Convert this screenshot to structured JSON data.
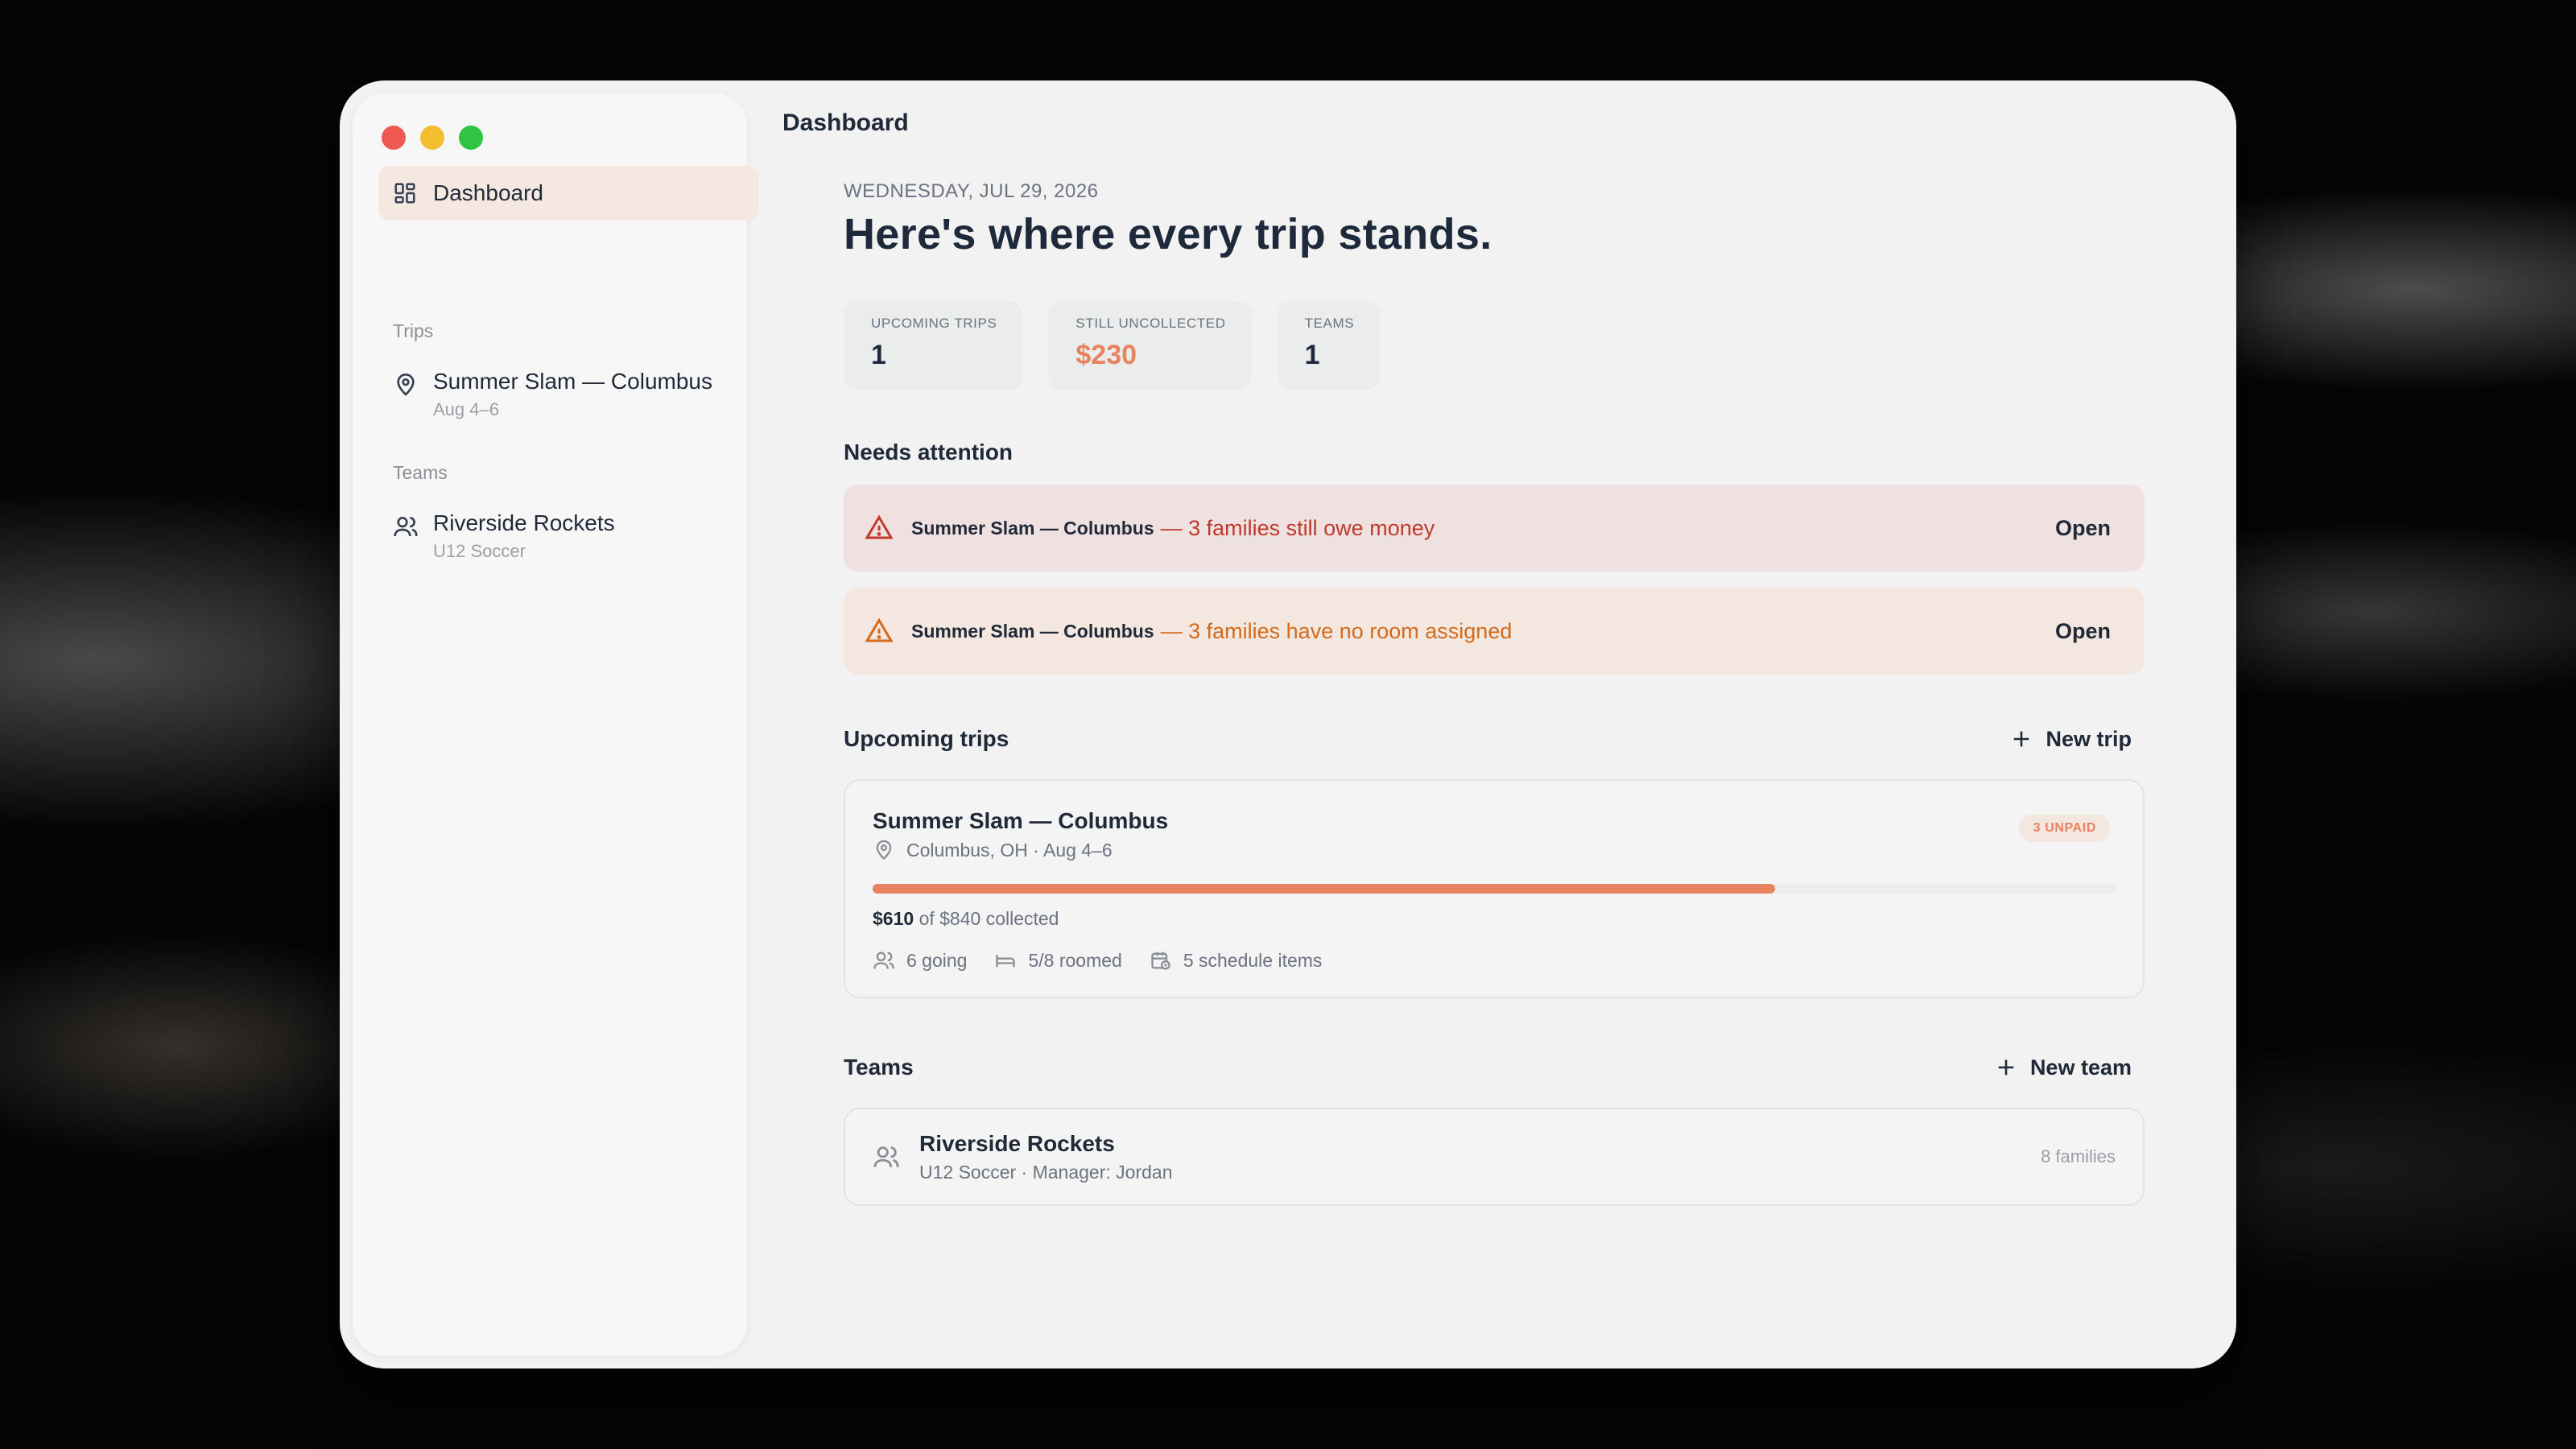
{
  "window": {
    "title": "Dashboard"
  },
  "sidebar": {
    "dashboard_label": "Dashboard",
    "trips_heading": "Trips",
    "trips": [
      {
        "title": "Summer Slam — Columbus",
        "dates": "Aug 4–6"
      }
    ],
    "teams_heading": "Teams",
    "teams": [
      {
        "title": "Riverside Rockets",
        "sub": "U12 Soccer"
      }
    ]
  },
  "header": {
    "date": "WEDNESDAY, JUL 29, 2026",
    "headline": "Here's where every trip stands."
  },
  "stats": [
    {
      "label": "UPCOMING TRIPS",
      "value": "1"
    },
    {
      "label": "STILL UNCOLLECTED",
      "value": "$230"
    },
    {
      "label": "TEAMS",
      "value": "1"
    }
  ],
  "attention": {
    "title": "Needs attention",
    "items": [
      {
        "trip": "Summer Slam — Columbus",
        "message": "— 3 families still owe money",
        "action": "Open",
        "severity": "error"
      },
      {
        "trip": "Summer Slam — Columbus",
        "message": "— 3 families have no room assigned",
        "action": "Open",
        "severity": "warning"
      }
    ]
  },
  "upcoming": {
    "title": "Upcoming trips",
    "new_label": "New trip",
    "trip": {
      "name": "Summer Slam — Columbus",
      "location": "Columbus, OH · Aug 4–6",
      "badge": "3 UNPAID",
      "collected_amount": "$610",
      "collected_rest": "of $840 collected",
      "progress": 0.726,
      "going": "6 going",
      "roomed": "5/8 roomed",
      "schedule": "5 schedule items"
    }
  },
  "teams": {
    "title": "Teams",
    "new_label": "New team",
    "team": {
      "name": "Riverside Rockets",
      "sub": "U12 Soccer · Manager: Jordan",
      "count": "8 families"
    }
  },
  "colors": {
    "accent": "#e9825f",
    "error": "#c0392b",
    "warning": "#d46a1c",
    "active_nav": "#f5e8e1"
  }
}
